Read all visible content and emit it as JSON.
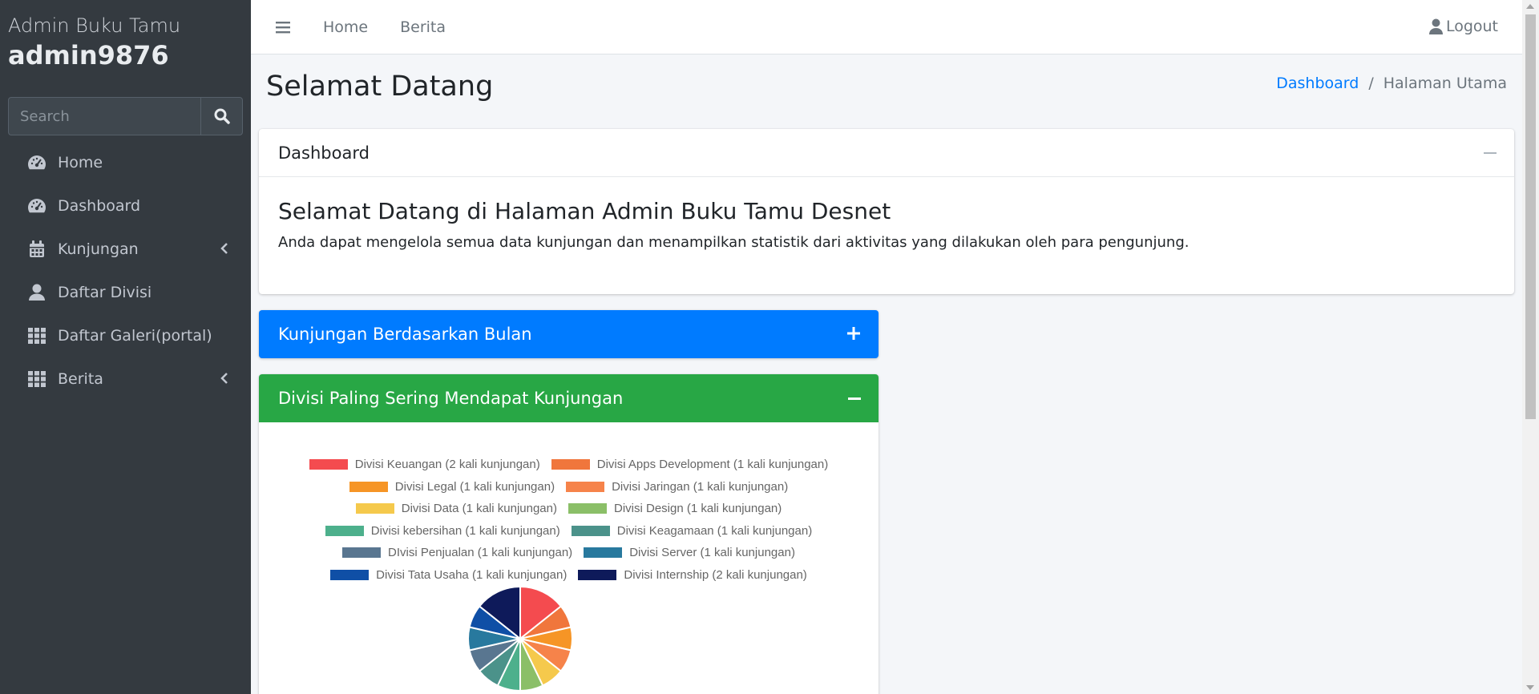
{
  "sidebar": {
    "title": "Admin Buku Tamu",
    "user": "admin9876",
    "search_placeholder": "Search",
    "items": [
      {
        "label": "Home",
        "icon": "tachometer-icon"
      },
      {
        "label": "Dashboard",
        "icon": "tachometer-icon"
      },
      {
        "label": "Kunjungan",
        "icon": "calendar-icon",
        "has_submenu": true
      },
      {
        "label": "Daftar Divisi",
        "icon": "user-icon"
      },
      {
        "label": "Daftar Galeri(portal)",
        "icon": "grid-icon"
      },
      {
        "label": "Berita",
        "icon": "grid-icon",
        "has_submenu": true
      }
    ]
  },
  "topbar": {
    "home": "Home",
    "berita": "Berita",
    "logout": "Logout"
  },
  "header": {
    "title": "Selamat Datang",
    "breadcrumb": [
      "Dashboard",
      "Halaman Utama"
    ]
  },
  "dashboard_card": {
    "title": "Dashboard",
    "heading": "Selamat Datang di Halaman Admin Buku Tamu Desnet",
    "text": "Anda dapat mengelola semua data kunjungan dan menampilkan statistik dari aktivitas yang dilakukan oleh para pengunjung."
  },
  "monthly_card": {
    "title": "Kunjungan Berdasarkan Bulan"
  },
  "division_card": {
    "title": "Divisi Paling Sering Mendapat Kunjungan"
  },
  "chart_data": {
    "type": "pie",
    "legend": [
      {
        "label": "Divisi Keuangan (2 kali kunjungan)",
        "value": 2,
        "color": "#f44b4f"
      },
      {
        "label": "Divisi Apps Development (1 kali kunjungan)",
        "value": 1,
        "color": "#f0763c"
      },
      {
        "label": "Divisi Legal (1 kali kunjungan)",
        "value": 1,
        "color": "#f69526"
      },
      {
        "label": "Divisi Jaringan  (1 kali kunjungan)",
        "value": 1,
        "color": "#f6834a"
      },
      {
        "label": "Divisi Data (1 kali kunjungan)",
        "value": 1,
        "color": "#f5c94c"
      },
      {
        "label": "Divisi Design (1 kali kunjungan)",
        "value": 1,
        "color": "#8bbf68"
      },
      {
        "label": "Divisi kebersihan (1 kali kunjungan)",
        "value": 1,
        "color": "#4db08c"
      },
      {
        "label": "Divisi Keagamaan (1 kali kunjungan)",
        "value": 1,
        "color": "#4b928a"
      },
      {
        "label": "DIvisi Penjualan (1 kali kunjungan)",
        "value": 1,
        "color": "#597690"
      },
      {
        "label": "Divisi Server (1 kali kunjungan)",
        "value": 1,
        "color": "#28799e"
      },
      {
        "label": "Divisi Tata Usaha (1 kali kunjungan)",
        "value": 1,
        "color": "#0f4fa6"
      },
      {
        "label": "Divisi Internship (2 kali kunjungan)",
        "value": 2,
        "color": "#0e1a5a"
      }
    ],
    "legend_rows": [
      [
        0,
        1
      ],
      [
        2,
        3
      ],
      [
        4,
        5
      ],
      [
        6,
        7
      ],
      [
        8,
        9
      ],
      [
        10,
        11
      ]
    ]
  }
}
